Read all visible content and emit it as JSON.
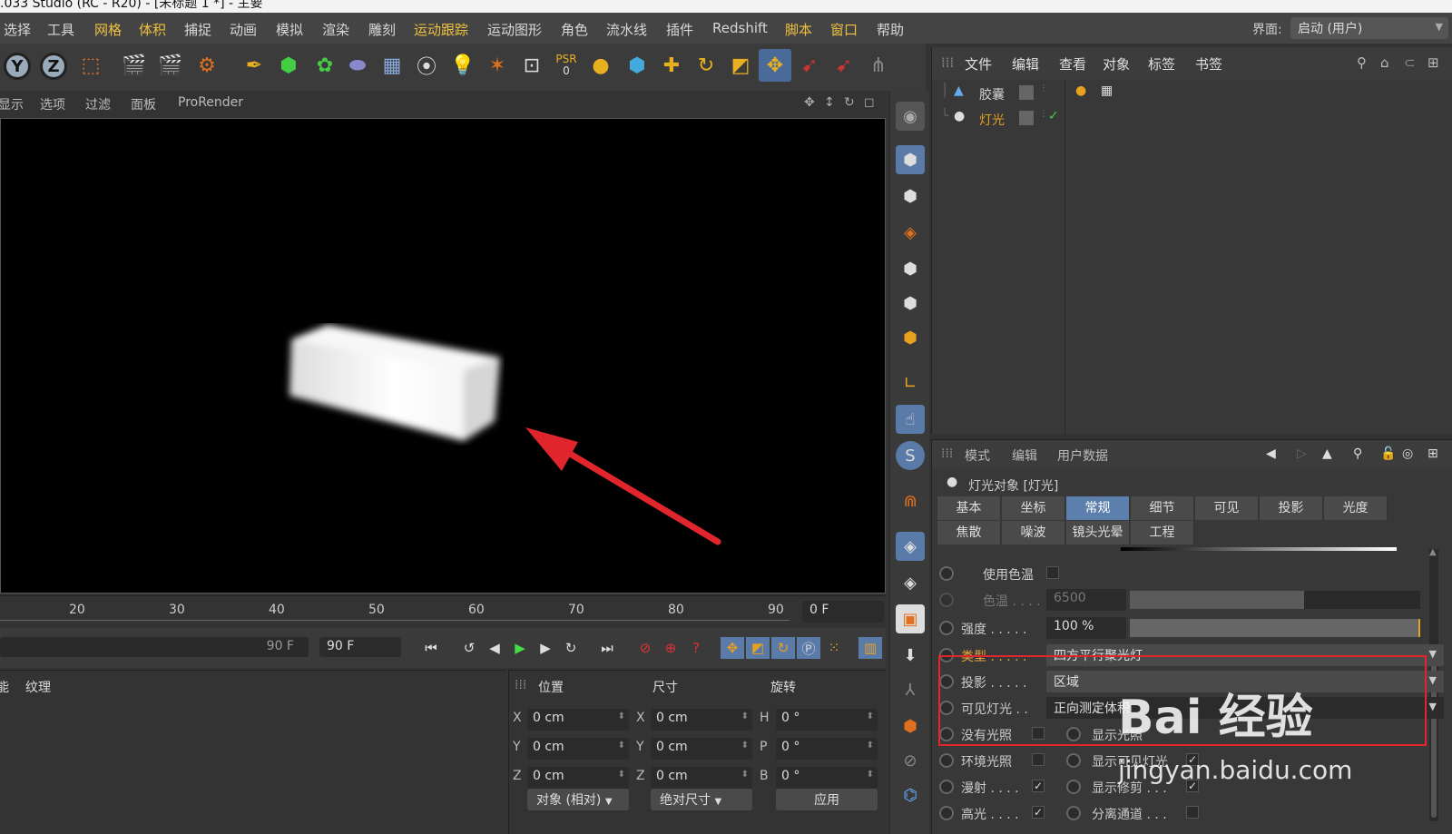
{
  "window": {
    "title": ".033 Studio (RC - R20) - [未标题 1 *] - 主要"
  },
  "menubar": {
    "items": [
      "选择",
      "工具",
      "网格",
      "体积",
      "捕捉",
      "动画",
      "模拟",
      "渲染",
      "雕刻",
      "运动跟踪",
      "运动图形",
      "角色",
      "流水线",
      "插件",
      "Redshift",
      "脚本",
      "窗口",
      "帮助"
    ],
    "ui_label": "界面:",
    "ui_value": "启动 (用户)"
  },
  "toolbar": {
    "axis_y": "Y",
    "axis_z": "Z",
    "psr_label": "PSR",
    "psr_value": "0"
  },
  "viewport_menu": {
    "items": [
      "显示",
      "选项",
      "过滤",
      "面板",
      "ProRender"
    ]
  },
  "timeline": {
    "ticks": [
      "20",
      "30",
      "40",
      "50",
      "60",
      "70",
      "80",
      "90"
    ],
    "current_frame": "0 F",
    "slider_value": "90 F",
    "end_frame": "90 F"
  },
  "material_panel": {
    "items": [
      "能",
      "纹理"
    ]
  },
  "coord_panel": {
    "headers": [
      "位置",
      "尺寸",
      "旋转"
    ],
    "pos": {
      "x_label": "X",
      "y_label": "Y",
      "z_label": "Z",
      "x": "0 cm",
      "y": "0 cm",
      "z": "0 cm"
    },
    "size": {
      "x_label": "X",
      "y_label": "Y",
      "z_label": "Z",
      "x": "0 cm",
      "y": "0 cm",
      "z": "0 cm"
    },
    "rot": {
      "h_label": "H",
      "p_label": "P",
      "b_label": "B",
      "h": "0 °",
      "p": "0 °",
      "b": "0 °"
    },
    "mode_select": "对象 (相对)",
    "size_select": "绝对尺寸",
    "apply_label": "应用"
  },
  "object_manager": {
    "menu": [
      "文件",
      "编辑",
      "查看",
      "对象",
      "标签",
      "书签"
    ],
    "objects": [
      {
        "name": "胶囊",
        "icon": "capsule-icon"
      },
      {
        "name": "灯光",
        "icon": "light-icon"
      }
    ]
  },
  "attribute_manager": {
    "menu": [
      "模式",
      "编辑",
      "用户数据"
    ],
    "title": "灯光对象 [灯光]",
    "tabs_row1": [
      "基本",
      "坐标",
      "常规",
      "细节",
      "可见",
      "投影",
      "光度"
    ],
    "tabs_row2": [
      "焦散",
      "噪波",
      "镜头光晕",
      "工程"
    ],
    "active_tab": "常规",
    "use_temp_label": "使用色温",
    "temp_label": "色温 . . . .",
    "temp_value": "6500",
    "intensity_label": "强度 . . . . .",
    "intensity_value": "100 %",
    "type_label": "类型 . . . . .",
    "type_value": "四方平行聚光灯",
    "shadow_label": "投影 . . . . .",
    "shadow_value": "区域",
    "visible_light_label": "可见灯光 . .",
    "visible_light_value": "正向测定体积",
    "no_illum_label": "没有光照",
    "ambient_label": "环境光照",
    "diffuse_label": "漫射 . . . .",
    "specular_label": "高光 . . . .",
    "show_illum_label": "显示光照",
    "show_visible_label": "显示可见灯光",
    "show_clip_label": "显示修剪 . . .",
    "sep_pass_label": "分离通道 . . ."
  },
  "watermark": {
    "logo": "Bai 经验",
    "url": "jingyan.baidu.com"
  },
  "colors": {
    "accent": "#5d7fae",
    "highlight_box": "#e0262c",
    "arrow": "#e0262c"
  }
}
